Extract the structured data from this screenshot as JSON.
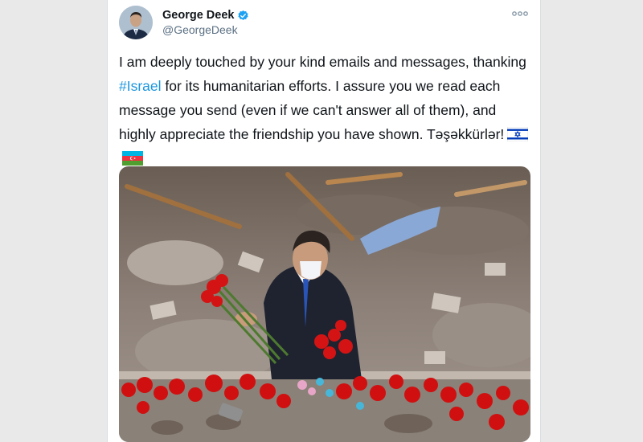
{
  "tweet": {
    "display_name": "George Deek",
    "handle": "@GeorgeDeek",
    "text_part1": "I am deeply touched by your kind emails and messages, thanking ",
    "hashtag": "#Israel",
    "text_part2": " for its humanitarian efforts. I assure you we read each message you send (even if we can't answer all of them), and highly appreciate the friendship you have shown. Təşəkkürlər!",
    "flags": [
      "israel-flag-icon",
      "azerbaijan-flag-icon"
    ]
  },
  "icons": {
    "verified": "verified-badge-icon",
    "more": "more-options-icon"
  },
  "colors": {
    "link": "#1b95e0",
    "verified": "#1da1f2",
    "text": "#0f1419",
    "secondary": "#5b7083"
  }
}
